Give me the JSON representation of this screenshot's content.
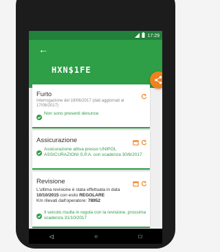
{
  "status": {
    "time": "17:29"
  },
  "plate": "HXN$1FE",
  "cards": {
    "furto": {
      "title": "Furto",
      "subtitle": "Interrogazione del 19/06/2017 (dati aggiornati al 17/06/2017)",
      "status": "Non sono presenti denunce"
    },
    "assicurazione": {
      "title": "Assicurazione",
      "status": "Assicurazione attiva presso UNIPOL ASSICURAZIONI S.P.A. con scadenza 30/6/2017"
    },
    "revisione": {
      "title": "Revisione",
      "line1": "L'ultima revisione è stata effettuata in data",
      "date": "10/10/2015",
      "esito_pre": " con esito ",
      "esito": "REGOLARE",
      "km_label": "Km rilevati dall'operatore: ",
      "km": "78952",
      "status": "Il veicolo risulta in regola con la revisione, prossima scadenza 31/10/2017"
    }
  },
  "colors": {
    "primary": "#2e9e47",
    "accent": "#f0821e"
  }
}
